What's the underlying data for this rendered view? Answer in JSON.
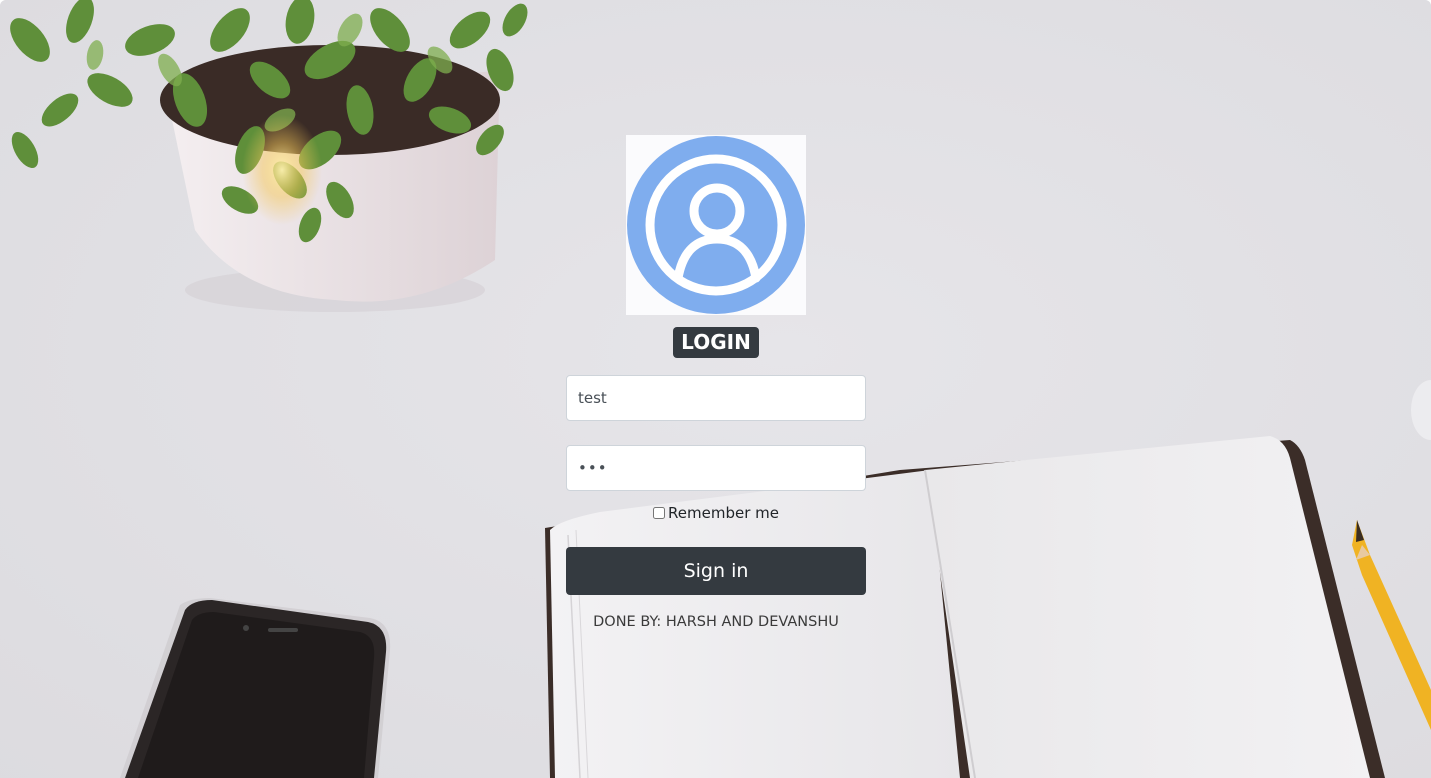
{
  "login": {
    "title": "LOGIN",
    "username_value": "test",
    "password_value": "abc",
    "remember_label": "Remember me",
    "remember_checked": false,
    "signin_label": "Sign in",
    "credits": "DONE BY: HARSH AND DEVANSHU"
  },
  "icons": {
    "avatar": "user-circle-icon"
  },
  "colors": {
    "background": "#e2e1e5",
    "avatar_blue": "#7fadee",
    "dark_button": "#343a40",
    "title_badge": "#343a40"
  }
}
